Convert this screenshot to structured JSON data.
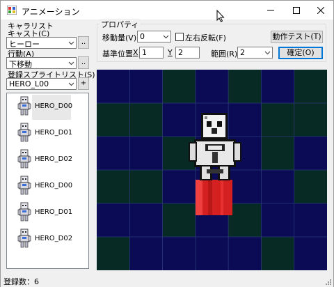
{
  "window": {
    "title": "アニメーション",
    "minimize_glyph": "—",
    "maximize_glyph": "☐",
    "close_glyph": "✕"
  },
  "left": {
    "section_label": "キャラリスト",
    "cast_label": "キャスト(C)",
    "cast_value": "ヒーロー",
    "action_label": "行動(A)",
    "action_value": "下移動",
    "sprite_list_label": "登録スプライトリスト(S)",
    "sprite_value": "HERO_L00",
    "more_glyph": "..",
    "add_glyph": "+",
    "sprites": [
      {
        "name": "HERO_D00",
        "selected": true
      },
      {
        "name": "HERO_D01",
        "selected": false
      },
      {
        "name": "HERO_D02",
        "selected": false
      },
      {
        "name": "HERO_D00",
        "selected": false
      },
      {
        "name": "HERO_D01",
        "selected": false
      },
      {
        "name": "HERO_D02",
        "selected": false
      }
    ]
  },
  "props": {
    "title": "プロパティ",
    "move_label": "移動量(V)",
    "move_value": "0",
    "flip_label": "左右反転(F)",
    "flip_checked": false,
    "test_button": "動作テスト(T)",
    "base_label": "基準位置",
    "x_label": "X",
    "x_value": "1",
    "y_label": "Y",
    "y_value": "2",
    "range_label": "範囲(R)",
    "range_value": "2",
    "confirm_button": "確定(O)"
  },
  "status": {
    "text": "登録数：6"
  },
  "colors": {
    "canvas_blue": "#0a0a55",
    "canvas_green": "#082a24",
    "grid": "#2a3a78",
    "highlight_red": "#d42020",
    "accent": "#0078d7"
  }
}
